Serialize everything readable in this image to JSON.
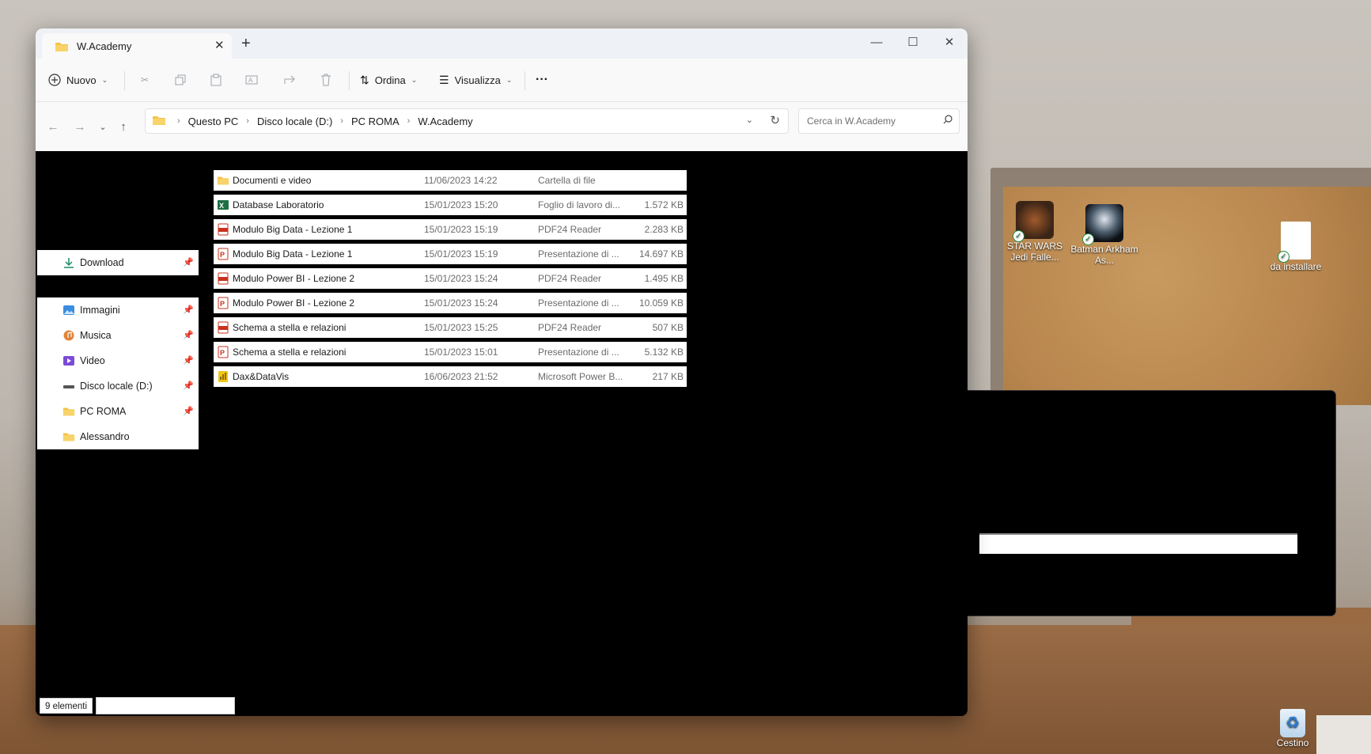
{
  "window": {
    "tab_title": "W.Academy",
    "tab_close": "✕",
    "tab_add": "+",
    "minimize": "—",
    "maximize": "☐",
    "close": "✕"
  },
  "toolbar": {
    "new_label": "Nuovo",
    "sort_label": "Ordina",
    "view_label": "Visualizza",
    "more_label": "···"
  },
  "address": {
    "crumbs": [
      "Questo PC",
      "Disco locale (D:)",
      "PC ROMA",
      "W.Academy"
    ],
    "search_placeholder": "Cerca in W.Academy"
  },
  "nav": {
    "download": "Download",
    "items": [
      {
        "label": "Immagini",
        "icon": "pictures-icon",
        "pinned": true
      },
      {
        "label": "Musica",
        "icon": "music-icon",
        "pinned": true
      },
      {
        "label": "Video",
        "icon": "video-icon",
        "pinned": true
      },
      {
        "label": "Disco locale (D:)",
        "icon": "drive-icon",
        "pinned": true
      },
      {
        "label": "PC ROMA",
        "icon": "folder-icon",
        "pinned": true
      },
      {
        "label": "Alessandro",
        "icon": "folder-icon",
        "pinned": false
      }
    ]
  },
  "files": [
    {
      "name": "Documenti e video",
      "date": "11/06/2023 14:22",
      "type": "Cartella di file",
      "size": "",
      "icon": "folder-icon"
    },
    {
      "name": "Database Laboratorio",
      "date": "15/01/2023 15:20",
      "type": "Foglio di lavoro di...",
      "size": "1.572 KB",
      "icon": "excel-icon"
    },
    {
      "name": "Modulo Big Data - Lezione 1",
      "date": "15/01/2023 15:19",
      "type": "PDF24 Reader",
      "size": "2.283 KB",
      "icon": "pdf-icon"
    },
    {
      "name": "Modulo Big Data - Lezione 1",
      "date": "15/01/2023 15:19",
      "type": "Presentazione di ...",
      "size": "14.697 KB",
      "icon": "powerpoint-icon"
    },
    {
      "name": "Modulo Power BI - Lezione 2",
      "date": "15/01/2023 15:24",
      "type": "PDF24 Reader",
      "size": "1.495 KB",
      "icon": "pdf-icon"
    },
    {
      "name": "Modulo Power BI - Lezione 2",
      "date": "15/01/2023 15:24",
      "type": "Presentazione di ...",
      "size": "10.059 KB",
      "icon": "powerpoint-icon"
    },
    {
      "name": "Schema a stella e relazioni",
      "date": "15/01/2023 15:25",
      "type": "PDF24 Reader",
      "size": "507 KB",
      "icon": "pdf-icon"
    },
    {
      "name": "Schema a stella e relazioni",
      "date": "15/01/2023 15:01",
      "type": "Presentazione di ...",
      "size": "5.132 KB",
      "icon": "powerpoint-icon"
    },
    {
      "name": "Dax&DataVis",
      "date": "16/06/2023 21:52",
      "type": "Microsoft Power B...",
      "size": "217 KB",
      "icon": "powerbi-icon"
    }
  ],
  "status": {
    "count": "9 elementi"
  },
  "desktop": {
    "icons": [
      {
        "label": "STAR WARS Jedi Falle...",
        "icon": "star-wars-game-icon"
      },
      {
        "label": "Batman Arkham As...",
        "icon": "batman-game-icon"
      },
      {
        "label": "da installare",
        "icon": "document-icon"
      }
    ],
    "recycle_bin": "Cestino"
  },
  "colors": {
    "accent": "#0067c0",
    "folder": "#f4c34a",
    "pdf": "#c8321e",
    "excel": "#1d7044"
  }
}
